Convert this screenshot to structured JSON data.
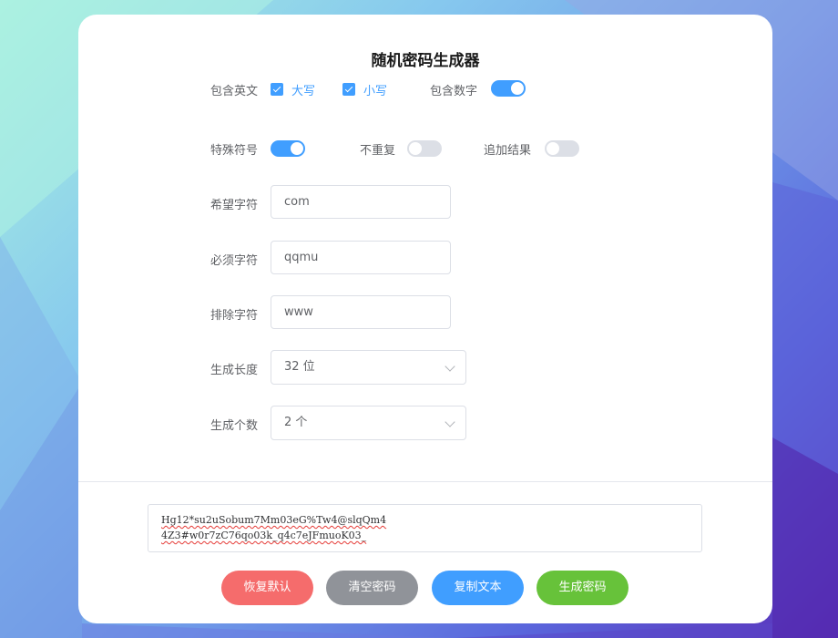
{
  "title": "随机密码生成器",
  "options": {
    "include_letters_label": "包含英文",
    "uppercase_label": "大写",
    "uppercase_checked": true,
    "lowercase_label": "小写",
    "lowercase_checked": true,
    "include_numbers_label": "包含数字",
    "include_numbers_on": true,
    "special_symbols_label": "特殊符号",
    "special_symbols_on": true,
    "no_repeat_label": "不重复",
    "no_repeat_on": false,
    "append_result_label": "追加结果",
    "append_result_on": false
  },
  "fields": {
    "desired_chars_label": "希望字符",
    "desired_chars_value": "com",
    "required_chars_label": "必须字符",
    "required_chars_value": "qqmu",
    "excluded_chars_label": "排除字符",
    "excluded_chars_value": "www",
    "length_label": "生成长度",
    "length_value": "32 位",
    "count_label": "生成个数",
    "count_value": "2 个"
  },
  "result": {
    "passwords": [
      "Hg12*su2uSobum7Mm03eG%Tw4@slqQm4",
      "4Z3#w0r7zC76qo03k_q4c7eJFmuoK03_"
    ]
  },
  "buttons": {
    "reset_label": "恢复默认",
    "clear_label": "清空密码",
    "copy_label": "复制文本",
    "generate_label": "生成密码"
  },
  "colors": {
    "accent": "#409eff",
    "reset": "#f56c6c",
    "clear": "#909399",
    "copy": "#409eff",
    "generate": "#67c23a"
  }
}
